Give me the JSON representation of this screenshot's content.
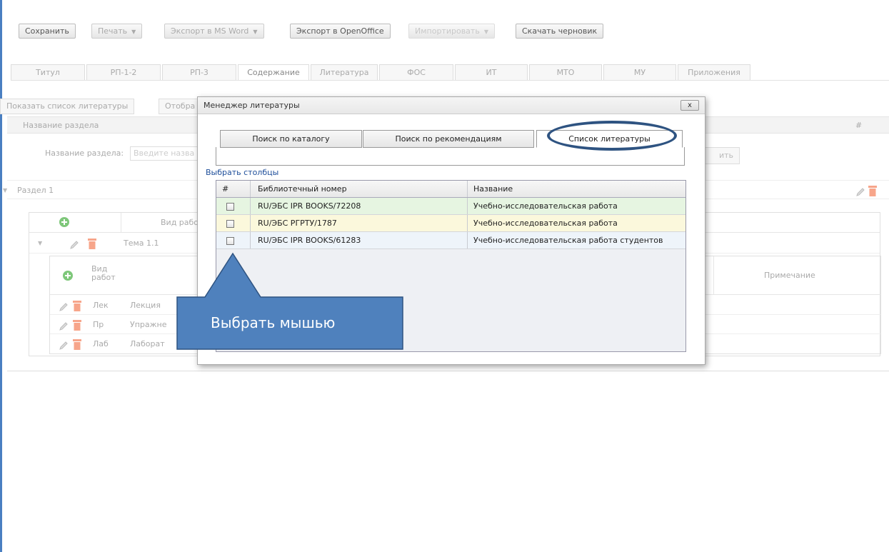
{
  "toolbar": {
    "save": "Сохранить",
    "print": "Печать",
    "export_word": "Экспорт в MS Word",
    "export_office": "Экспорт в OpenOffice",
    "import": "Импортировать",
    "download_draft": "Скачать черновик"
  },
  "tabs": [
    "Титул",
    "РП-1-2",
    "РП-3",
    "Содержание",
    "Литература",
    "ФОС",
    "ИТ",
    "МТО",
    "МУ",
    "Приложения"
  ],
  "active_tab": "Содержание",
  "subbar": {
    "show_list": "Показать список литературы",
    "show_trunc": "Отобра"
  },
  "grid_header": {
    "section_name": "Название раздела",
    "hash": "#"
  },
  "section_form": {
    "label": "Название раздела:",
    "placeholder": "Введите назва",
    "button_trunc": "ить"
  },
  "section": {
    "label": "Раздел 1"
  },
  "inner": {
    "work_type_header": "Вид рабо",
    "topic": "Тема 1.1",
    "sub_header_type": "Вид работ",
    "note_header": "Примечание",
    "rows": [
      {
        "code": "Лек",
        "name": "Лекция"
      },
      {
        "code": "Пр",
        "name": "Упражне"
      },
      {
        "code": "Лаб",
        "name": "Лаборат"
      }
    ]
  },
  "dialog": {
    "title": "Менеджер литературы",
    "close": "x",
    "tabs": [
      "Поиск по каталогу",
      "Поиск по рекомендациям",
      "Список литературы"
    ],
    "active_tab": "Список литературы",
    "choose_columns": "Выбрать столбцы",
    "columns": [
      "#",
      "Библиотечный номер",
      "Название"
    ],
    "rows": [
      {
        "number": "RU/ЭБС IPR BOOKS/72208",
        "title": "Учебно-исследовательская работа",
        "bg": "#e6f5e1"
      },
      {
        "number": "RU/ЭБС РГРТУ/1787",
        "title": "Учебно-исследовательская работа",
        "bg": "#fbf8dc"
      },
      {
        "number": "RU/ЭБС IPR BOOKS/61283",
        "title": "Учебно-исследовательская работа студентов",
        "bg": "#eef4fa"
      }
    ]
  },
  "callout": {
    "text": "Выбрать мышью",
    "fill": "#4f81bd",
    "stroke": "#2e5381"
  }
}
